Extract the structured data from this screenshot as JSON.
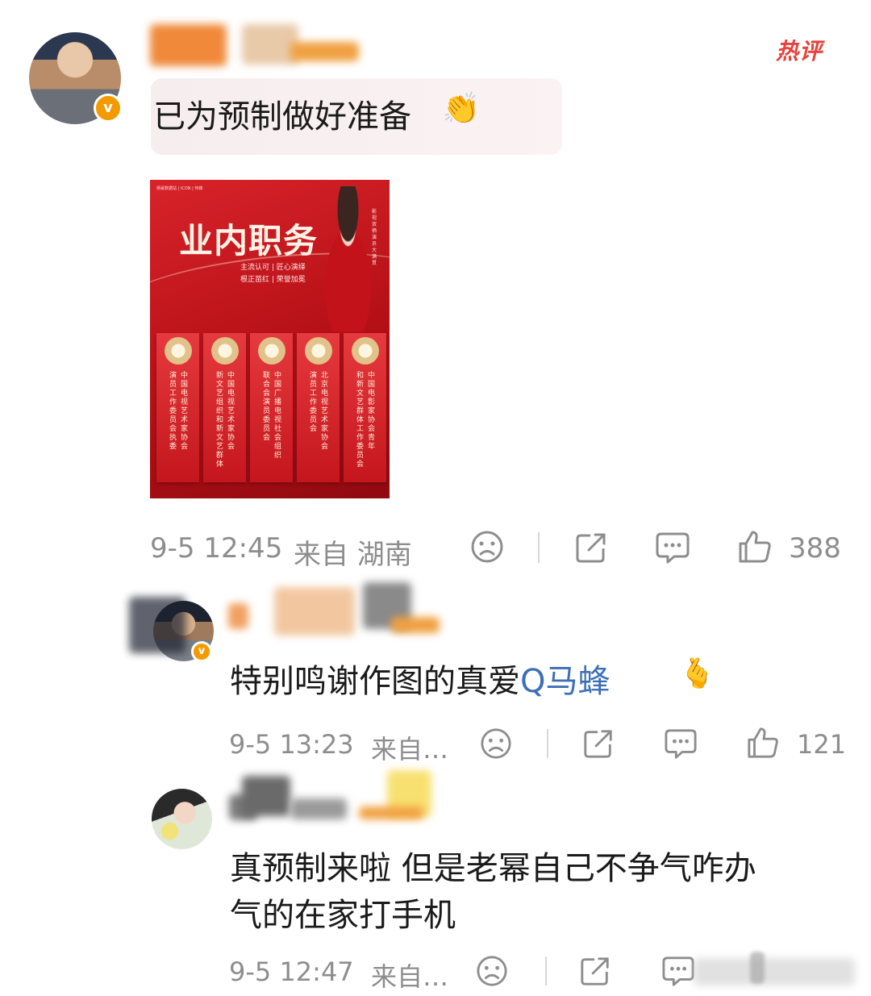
{
  "main_comment": {
    "hot_tag": "热评",
    "text": "已为预制做好准备",
    "emoji": "👏",
    "verified_mark": "v",
    "meta": {
      "date_time": "9-5 12:45",
      "location": "来自 湖南",
      "like_count": "388"
    }
  },
  "poster": {
    "top_caption": "杨幂数据站 | ICON | 传媒",
    "title": "业内职务",
    "subline_1": "主流认可 | 匠心演绎",
    "subline_2": "根正苗红 | 荣誉加冕",
    "side_caption": "影视双栖 演员大满贯",
    "columns": [
      {
        "line1": "中国电视艺术家协会",
        "line2": "演员工作委员会 执委"
      },
      {
        "line1": "中国电视艺术家协会",
        "line2": "新文艺组织和新文艺群体"
      },
      {
        "line1": "中国广播电视社会组织",
        "line2": "联合会演员委员会"
      },
      {
        "line1": "北京电视艺术家协会",
        "line2": "演员工作委员会"
      },
      {
        "line1": "中国电影家协会青年",
        "line2": "和新文艺群体工作委员会"
      }
    ]
  },
  "reply_1": {
    "text": "特别鸣谢作图的真爱",
    "mention_icon": "Q",
    "mention": "马蜂",
    "emoji": "🫰",
    "verified_mark": "v",
    "meta": {
      "date_time": "9-5 13:23",
      "location": "来自…",
      "like_count": "121"
    }
  },
  "reply_2": {
    "line1": "真预制来啦 但是老幂自己不争气咋办",
    "line2": "气的在家打手机",
    "meta": {
      "date_time": "9-5 12:47",
      "location": "来自…"
    }
  },
  "colors": {
    "hot": "#e8413a",
    "mention": "#3d6fb5",
    "verified": "#f39a00",
    "meta_gray": "#8d8d8d"
  },
  "icons": [
    "sad-face-icon",
    "share-icon",
    "comment-icon",
    "thumbs-up-icon"
  ]
}
